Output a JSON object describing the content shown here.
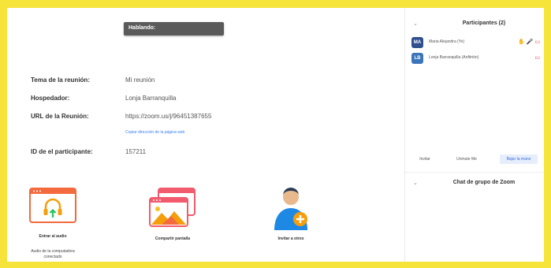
{
  "speaking_label": "Hablando:",
  "meeting": {
    "topic_label": "Tema de la reunión:",
    "topic_value": "Mi reunión",
    "host_label": "Hospedador:",
    "host_value": "Lonja Barranquilla",
    "url_label": "URL de la Reunión:",
    "url_value": "https://zoom.us/j/96451387655",
    "copy_link": "Copiar dirección de la página web",
    "participant_id_label": "ID de el participante:",
    "participant_id_value": "157211"
  },
  "actions": [
    {
      "label": "Entrar al audio",
      "sub": "Audio de la computadora conectado",
      "icon": "headphones-icon"
    },
    {
      "label": "Compartir pantalla",
      "icon": "share-screen-icon"
    },
    {
      "label": "Invitar a otros",
      "icon": "invite-user-icon"
    }
  ],
  "participants_panel": {
    "title": "Participantes (2)",
    "items": [
      {
        "initials": "MA",
        "name": "Maria Alejandra (Yo)",
        "color": "#2f4f8f"
      },
      {
        "initials": "LB",
        "name": "Lonja Barranquilla (Anfitrión)",
        "color": "#3b74b8"
      }
    ],
    "buttons": {
      "invite": "Invitar",
      "unmute": "Unmute Me",
      "lower_hand": "Bajar la mano"
    }
  },
  "chat_panel": {
    "title": "Chat de grupo de Zoom"
  },
  "colors": {
    "accent": "#f7e43a",
    "danger": "#e53935",
    "brand_blue": "#3b82f6",
    "tile_orange": "#f26a3d",
    "tile_pink": "#f25a6e"
  }
}
